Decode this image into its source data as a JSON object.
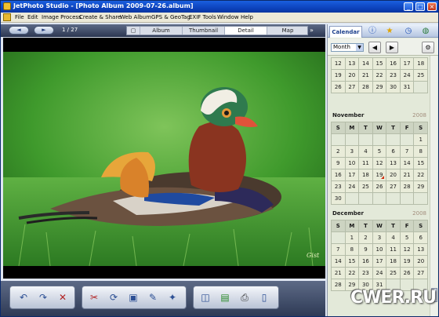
{
  "window": {
    "title": "JetPhoto Studio - [Photo Album 2009-07-26.album]",
    "minimize_glyph": "_",
    "maximize_glyph": "□",
    "close_glyph": "×"
  },
  "menu": [
    "File",
    "Edit",
    "Image Process",
    "Create & Share",
    "Web Album",
    "GPS & GeoTag",
    "EXIF Tools",
    "Window",
    "Help"
  ],
  "nav": {
    "prev_glyph": "◄",
    "next_glyph": "►",
    "counter": "1 / 27",
    "more_glyph": "»",
    "tabs": [
      "Album",
      "Thumbnail",
      "Detail",
      "Map"
    ],
    "active_tab": "Detail"
  },
  "photo": {
    "signature": "Gist"
  },
  "toolbar_icons": [
    [
      "undo-icon",
      "redo-icon",
      "delete-icon"
    ],
    [
      "cut-icon",
      "rotate-icon",
      "resize-icon",
      "edit-icon",
      "effects-icon"
    ],
    [
      "slideshow-icon",
      "wallpaper-icon",
      "print-icon",
      "phone-icon"
    ]
  ],
  "calendar": {
    "tab_label": "Calendar",
    "view_select": "Month",
    "weekday_headers": [
      "S",
      "M",
      "T",
      "W",
      "T",
      "F",
      "S"
    ],
    "months": [
      {
        "name": "",
        "year": "",
        "rows": [
          [
            "",
            "12",
            "13",
            "14",
            "15",
            "16",
            "17",
            "18"
          ],
          [
            "19",
            "20",
            "21",
            "22",
            "23",
            "24",
            "25"
          ],
          [
            "26",
            "27",
            "28",
            "29",
            "30",
            "31",
            ""
          ]
        ]
      },
      {
        "name": "November",
        "year": "2008",
        "rows": [
          [
            "",
            "",
            "",
            "",
            "",
            "",
            "1"
          ],
          [
            "2",
            "3",
            "4",
            "5",
            "6",
            "7",
            "8"
          ],
          [
            "9",
            "10",
            "11",
            "12",
            "13",
            "14",
            "15"
          ],
          [
            "16",
            "17",
            "18",
            "19",
            "20",
            "21",
            "22"
          ],
          [
            "23",
            "24",
            "25",
            "26",
            "27",
            "28",
            "29"
          ],
          [
            "30",
            "",
            "",
            "",
            "",
            "",
            ""
          ]
        ]
      },
      {
        "name": "December",
        "year": "2008",
        "rows": [
          [
            "",
            "1",
            "2",
            "3",
            "4",
            "5",
            "6"
          ],
          [
            "7",
            "8",
            "9",
            "10",
            "11",
            "12",
            "13"
          ],
          [
            "14",
            "15",
            "16",
            "17",
            "18",
            "19",
            "20"
          ],
          [
            "21",
            "22",
            "23",
            "24",
            "25",
            "26",
            "27"
          ],
          [
            "28",
            "29",
            "30",
            "31",
            "",
            "",
            ""
          ]
        ]
      }
    ]
  },
  "watermark": "CWER.RU"
}
